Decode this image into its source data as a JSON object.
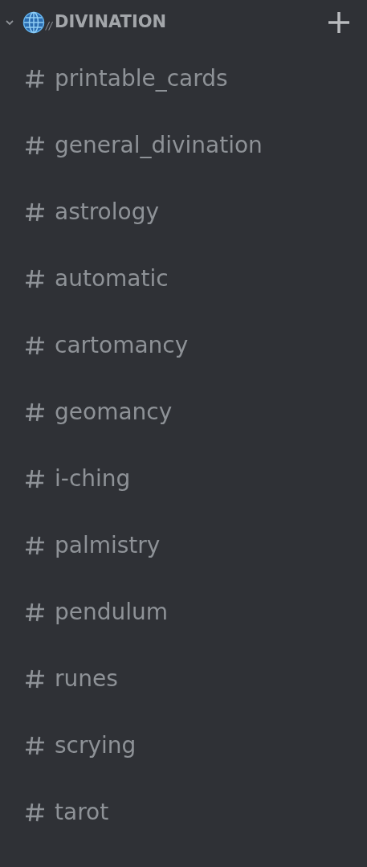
{
  "category": {
    "expanded": true,
    "separator": "//",
    "title": "DIVINATION"
  },
  "channels": [
    {
      "name": "printable_cards"
    },
    {
      "name": "general_divination"
    },
    {
      "name": "astrology"
    },
    {
      "name": "automatic"
    },
    {
      "name": "cartomancy"
    },
    {
      "name": "geomancy"
    },
    {
      "name": "i-ching"
    },
    {
      "name": "palmistry"
    },
    {
      "name": "pendulum"
    },
    {
      "name": "runes"
    },
    {
      "name": "scrying"
    },
    {
      "name": "tarot"
    }
  ]
}
